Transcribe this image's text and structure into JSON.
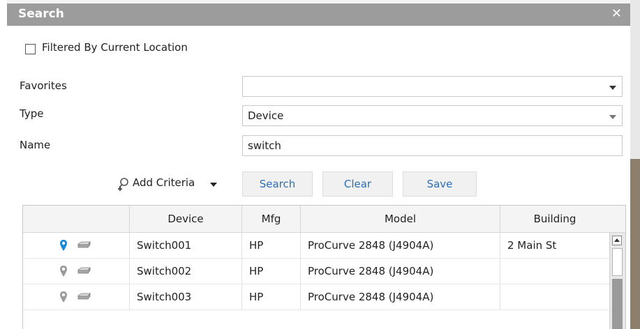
{
  "dialog": {
    "title": "Search",
    "close_label": "✕"
  },
  "filter": {
    "label": "Filtered By Current Location",
    "checked": false
  },
  "form": {
    "favorites_label": "Favorites",
    "favorites_value": "",
    "type_label": "Type",
    "type_value": "Device",
    "name_label": "Name",
    "name_value": "switch"
  },
  "actions": {
    "add_criteria_label": "Add Criteria",
    "search_label": "Search",
    "clear_label": "Clear",
    "save_label": "Save"
  },
  "table": {
    "columns": [
      "",
      "Device",
      "Mfg",
      "Model",
      "Building"
    ],
    "rows": [
      {
        "device": "Switch001",
        "mfg": "HP",
        "model": "ProCurve 2848 (J4904A)",
        "building": "2 Main St",
        "pin_color": "#1a88d8"
      },
      {
        "device": "Switch002",
        "mfg": "HP",
        "model": "ProCurve 2848 (J4904A)",
        "building": "",
        "pin_color": "#9b9b9b"
      },
      {
        "device": "Switch003",
        "mfg": "HP",
        "model": "ProCurve 2848 (J4904A)",
        "building": "",
        "pin_color": "#9b9b9b"
      }
    ]
  },
  "icons": {
    "close": "close-icon",
    "checkbox": "checkbox-icon",
    "dropdown": "chevron-down-icon",
    "add_criteria": "add-search-icon",
    "location_pin": "map-pin-icon",
    "device": "network-switch-icon"
  },
  "colors": {
    "titlebar": "#9c9c9c",
    "link_text": "#2a6fb5",
    "active_pin": "#1a88d8",
    "inactive_pin": "#9b9b9b"
  }
}
